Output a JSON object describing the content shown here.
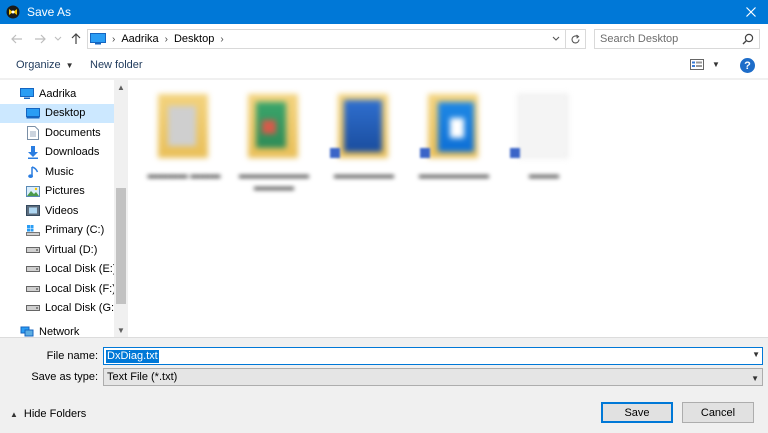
{
  "window": {
    "title": "Save As"
  },
  "address": {
    "crumbs": [
      "Aadrika",
      "Desktop"
    ]
  },
  "search": {
    "placeholder": "Search Desktop"
  },
  "toolbar": {
    "organize_label": "Organize",
    "new_folder_label": "New folder",
    "help_label": "?"
  },
  "nav": {
    "items": [
      {
        "label": "Aadrika",
        "icon": "computer-icon",
        "level": 0
      },
      {
        "label": "Desktop",
        "icon": "desktop-icon",
        "level": 1,
        "selected": true
      },
      {
        "label": "Documents",
        "icon": "documents-icon",
        "level": 1
      },
      {
        "label": "Downloads",
        "icon": "downloads-icon",
        "level": 1
      },
      {
        "label": "Music",
        "icon": "music-icon",
        "level": 1
      },
      {
        "label": "Pictures",
        "icon": "pictures-icon",
        "level": 1
      },
      {
        "label": "Videos",
        "icon": "videos-icon",
        "level": 1
      },
      {
        "label": "Primary (C:)",
        "icon": "windows-drive-icon",
        "level": 1
      },
      {
        "label": "Virtual (D:)",
        "icon": "drive-icon",
        "level": 1
      },
      {
        "label": "Local Disk (E:)",
        "icon": "drive-icon",
        "level": 1
      },
      {
        "label": "Local Disk (F:)",
        "icon": "drive-icon",
        "level": 1
      },
      {
        "label": "Local Disk (G:)",
        "icon": "drive-icon",
        "level": 1
      },
      {
        "label": "Network",
        "icon": "network-icon",
        "level": 0
      }
    ]
  },
  "form": {
    "file_name_label": "File name:",
    "file_name_value": "DxDiag.txt",
    "save_as_type_label": "Save as type:",
    "save_as_type_value": "Text File (*.txt)",
    "hide_folders_label": "Hide Folders",
    "save_label": "Save",
    "cancel_label": "Cancel"
  },
  "colors": {
    "accent": "#0078d7",
    "selection": "#cce8ff"
  }
}
